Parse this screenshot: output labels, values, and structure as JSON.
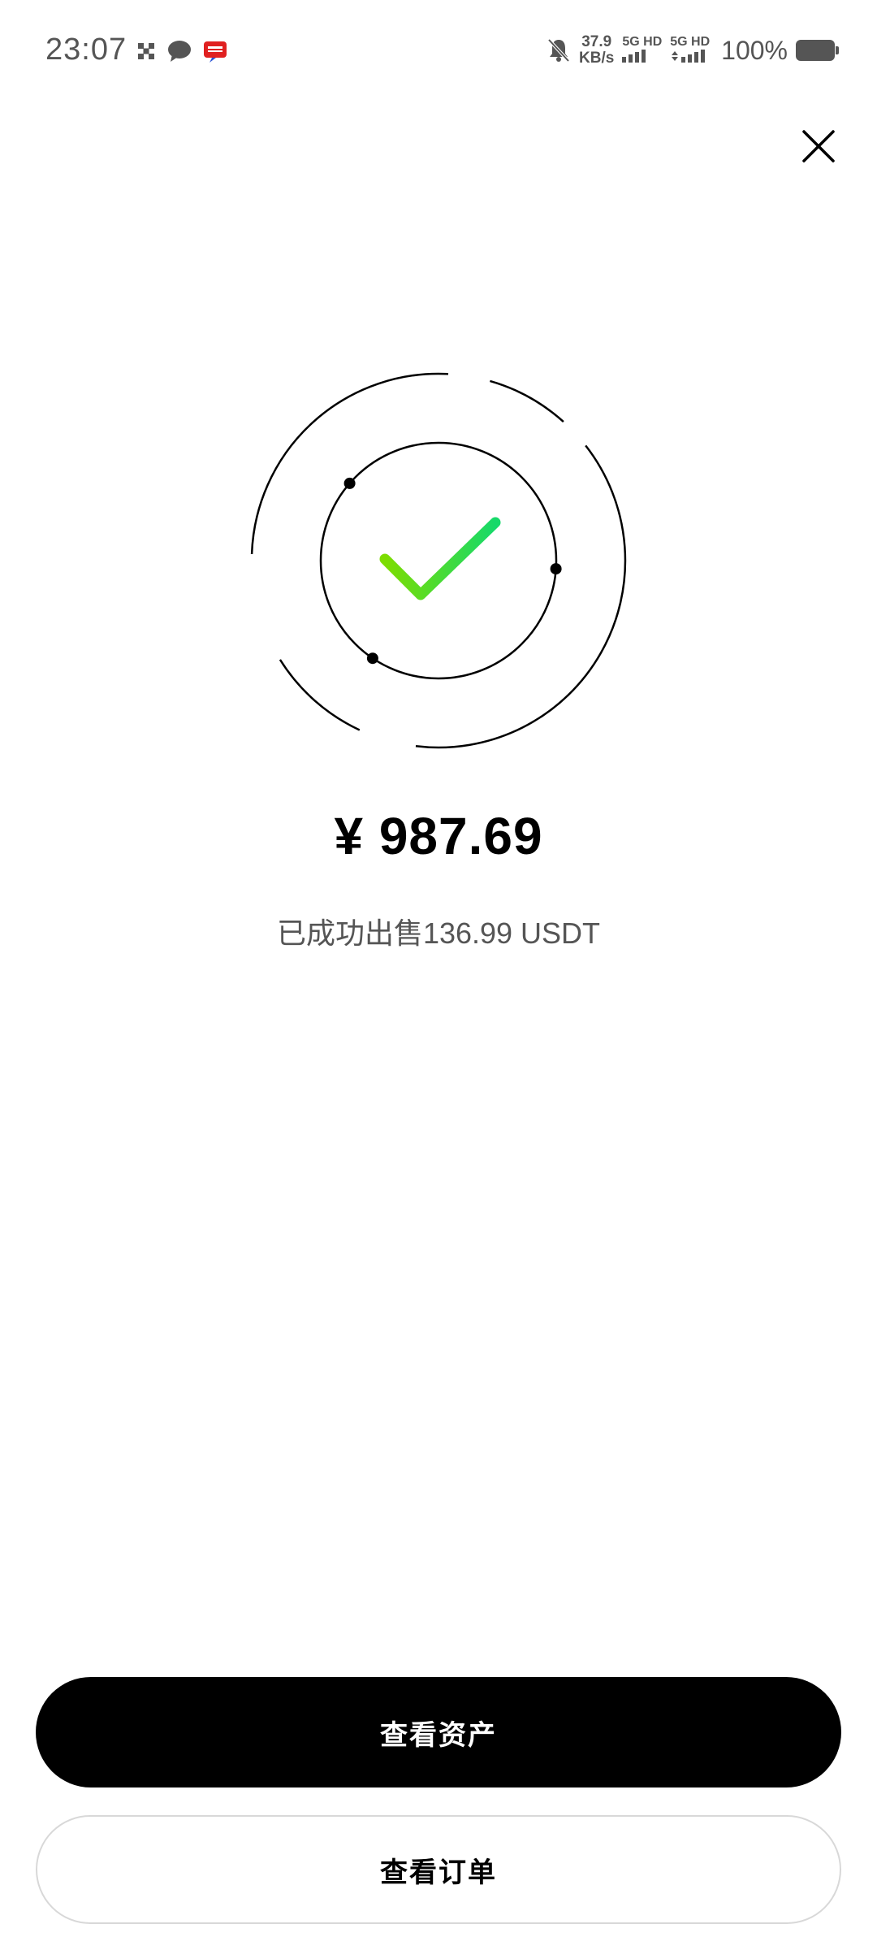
{
  "status_bar": {
    "time": "23:07",
    "left_icons": [
      "grid-icon",
      "chat-bubble-icon",
      "red-app-icon"
    ],
    "right": {
      "speed_value": "37.9",
      "speed_unit": "KB/s",
      "sim1": "5G HD",
      "sim2": "5G HD",
      "battery_percent": "100%"
    }
  },
  "close_icon": "close-icon",
  "success": {
    "icon": "checkmark-icon",
    "check_gradient": [
      "#7ddd00",
      "#16d96a"
    ],
    "amount": "¥ 987.69",
    "message": "已成功出售136.99 USDT"
  },
  "actions": {
    "view_assets": "查看资产",
    "view_orders": "查看订单"
  }
}
